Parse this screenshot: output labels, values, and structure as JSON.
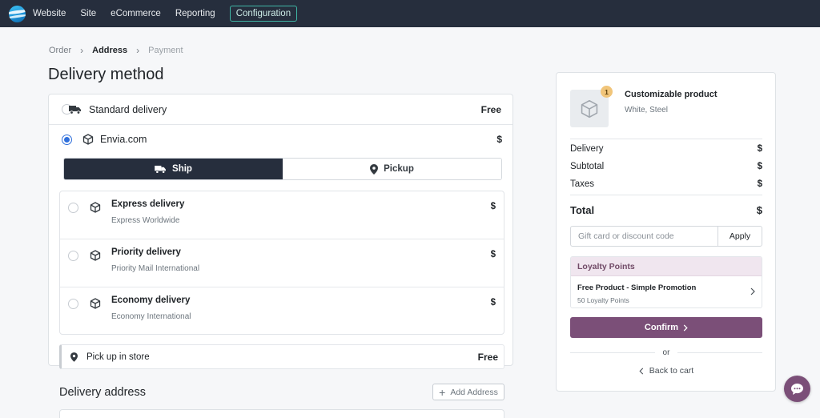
{
  "nav": {
    "items": [
      "Website",
      "Site",
      "eCommerce",
      "Reporting"
    ],
    "active": "Configuration"
  },
  "breadcrumb": {
    "order": "Order",
    "address": "Address",
    "payment": "Payment"
  },
  "page_title": "Delivery method",
  "methods": {
    "standard": {
      "label": "Standard delivery",
      "price": "Free"
    },
    "envia": {
      "label": "Envia.com",
      "price": "$"
    },
    "tabs": {
      "ship": "Ship",
      "pickup": "Pickup"
    },
    "carriers": [
      {
        "name": "Express delivery",
        "sub": "Express Worldwide",
        "price": "$"
      },
      {
        "name": "Priority delivery",
        "sub": "Priority Mail International",
        "price": "$"
      },
      {
        "name": "Economy delivery",
        "sub": "Economy International",
        "price": "$"
      }
    ],
    "pickup_store": {
      "label": "Pick up in store",
      "price": "Free"
    }
  },
  "address": {
    "title": "Delivery address",
    "add_label": "Add Address"
  },
  "summary": {
    "qty": "1",
    "product_name": "Customizable product",
    "product_variant": "White, Steel",
    "rows": [
      {
        "label": "Delivery",
        "value": "$"
      },
      {
        "label": "Subtotal",
        "value": "$"
      },
      {
        "label": "Taxes",
        "value": "$"
      }
    ],
    "total_label": "Total",
    "total_value": "$",
    "promo_placeholder": "Gift card or discount code",
    "apply_label": "Apply",
    "loyalty": {
      "head": "Loyalty Points",
      "item_name": "Free Product - Simple Promotion",
      "item_sub": "50 Loyalty Points"
    },
    "confirm_label": "Confirm",
    "or_label": "or",
    "back_label": "Back to cart"
  },
  "colors": {
    "topbar": "#262e3d",
    "accent": "#7b4f78",
    "radio": "#2f6fdb"
  }
}
